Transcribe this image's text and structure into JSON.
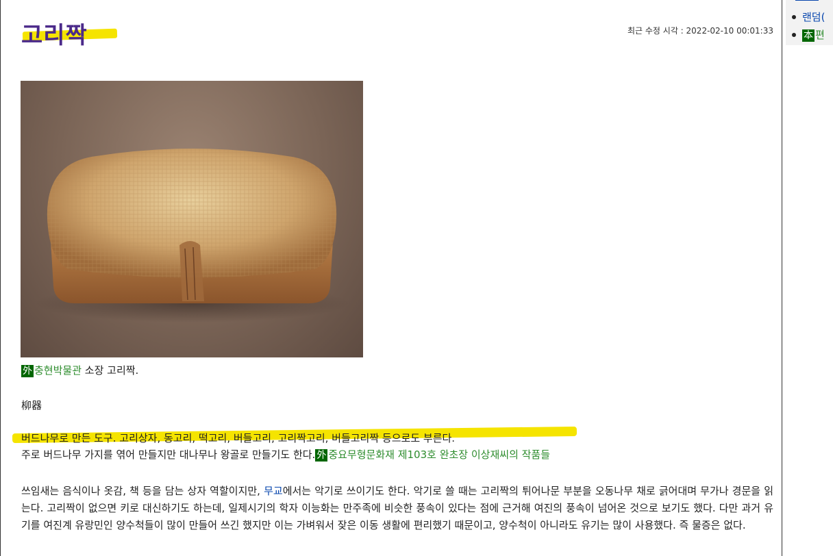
{
  "page": {
    "title": "고리짝",
    "modified": "최근 수정 시각 : 2022-02-10 00:01:33"
  },
  "sidebar": {
    "items": [
      {
        "label": "랜덤("
      },
      {
        "tag": "本",
        "label": "편"
      }
    ]
  },
  "caption": {
    "tag": "外",
    "link": "충현박물관",
    "text": " 소장 고리짝."
  },
  "hanja": "柳器",
  "paragraph1": {
    "line1": "버드나무로 만든 도구. 고리상자, 동고리, 떡고리, 버들고리, 고리짝고리, 버들고리짝 등으로도 부른다.",
    "line2_text": "주로 버드나무 가지를 엮어 만들지만 대나무나 왕골로 만들기도 한다.",
    "line2_tag": "外",
    "line2_link": "중요무형문화재 제103호 완초장 이상재씨의 작품들"
  },
  "paragraph2": {
    "before": "쓰임새는 음식이나 옷감, 책 등을 담는 상자 역할이지만, ",
    "link": "무교",
    "after": "에서는 악기로 쓰이기도 한다. 악기로 쓸 때는 고리짝의 튀어나문 부분을 오동나무 채로 긁어대며 무가나 경문을 읽는다. 고리짝이 없으면 키로 대신하기도 하는데, 일제시기의 학자 이능화는 만주족에 비슷한 풍속이 있다는 점에 근거해 여진의 풍속이 넘어온 것으로 보기도 했다. 다만 과거 유기를 여진계 유랑민인 양수척들이 많이 만들어 쓰긴 했지만 이는 가벼워서 잦은 이동 생활에 편리했기 때문이고, 양수척이 아니라도 유기는 많이 사용했다. 즉 물증은 없다."
  },
  "colors": {
    "highlight": "#f5e400",
    "title": "#4b2a8a",
    "external_tag_bg": "#006600",
    "external_link": "#2d8c2d",
    "internal_link": "#0645ad"
  }
}
